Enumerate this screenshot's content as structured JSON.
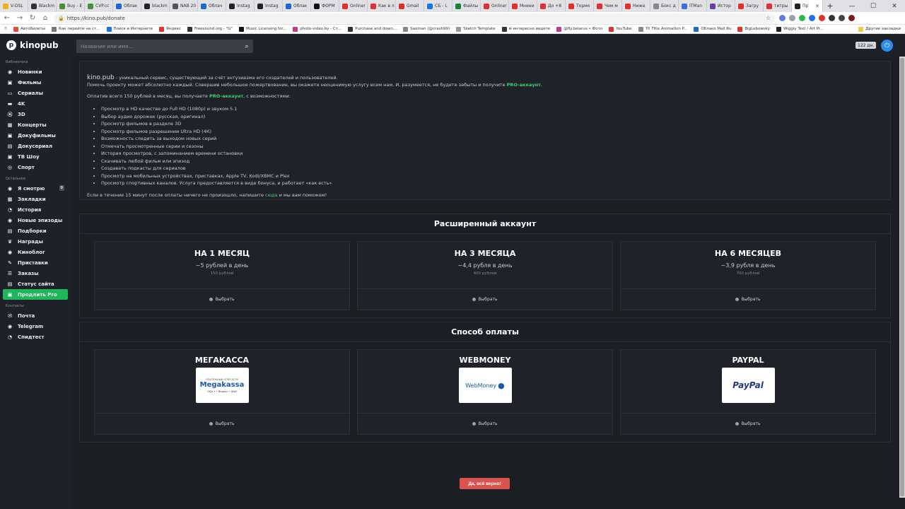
{
  "browser": {
    "tabs": [
      {
        "label": "V-DSL",
        "color": "#f2b01e"
      },
      {
        "label": "Blackm",
        "color": "#333333"
      },
      {
        "label": "Buy - E",
        "color": "#4a8d3a"
      },
      {
        "label": "CVP.cc",
        "color": "#4a8d3a"
      },
      {
        "label": "Облак",
        "color": "#2266cc"
      },
      {
        "label": "blackm",
        "color": "#222222"
      },
      {
        "label": "NAB 20",
        "color": "#555555"
      },
      {
        "label": "Облач",
        "color": "#2266cc"
      },
      {
        "label": "Instag",
        "color": "#222222"
      },
      {
        "label": "Instag",
        "color": "#222222"
      },
      {
        "label": "Облак",
        "color": "#2266cc"
      },
      {
        "label": "ФОРМ",
        "color": "#111111"
      },
      {
        "label": "Onliner",
        "color": "#e0312a"
      },
      {
        "label": "Как в л",
        "color": "#e0312a"
      },
      {
        "label": "Gmail",
        "color": "#d93025"
      },
      {
        "label": "СБ - L",
        "color": "#1a73e8"
      },
      {
        "label": "Файлы",
        "color": "#188038"
      },
      {
        "label": "Onliner",
        "color": "#e0312a"
      },
      {
        "label": "Мнени",
        "color": "#e0312a"
      },
      {
        "label": "До +8",
        "color": "#e0312a"
      },
      {
        "label": "Тормо",
        "color": "#e0312a"
      },
      {
        "label": "Чем м",
        "color": "#e0312a"
      },
      {
        "label": "Ниже",
        "color": "#e0312a"
      },
      {
        "label": "Бокс д",
        "color": "#888888"
      },
      {
        "label": "ITMan",
        "color": "#3d6fd6"
      },
      {
        "label": "Истор",
        "color": "#6b3fa0"
      },
      {
        "label": "Загру",
        "color": "#e0312a"
      },
      {
        "label": "титры",
        "color": "#e0312a"
      },
      {
        "label": "Пр",
        "color": "#222222",
        "active": true
      }
    ],
    "new_tab": "+",
    "url": "https://kino.pub/donate",
    "bookmarks": [
      {
        "label": "Автобилеты",
        "color": "#e84c3d"
      },
      {
        "label": "Как перейти на ст...",
        "color": "#777777"
      },
      {
        "label": "Поиск в Интернете",
        "color": "#1a73e8"
      },
      {
        "label": "Яндекс",
        "color": "#e0312a"
      },
      {
        "label": "Freesound.org - \"G\"",
        "color": "#333333"
      },
      {
        "label": "Music Licensing for...",
        "color": "#111111"
      },
      {
        "label": "photo-video.by - Ст...",
        "color": "#c0398a"
      },
      {
        "label": "Purchase and down...",
        "color": "#333333"
      },
      {
        "label": "Saoman (@crash99)",
        "color": "#888888"
      },
      {
        "label": "Sketch Template",
        "color": "#999999"
      },
      {
        "label": "м интересно ведете",
        "color": "#333333"
      },
      {
        "label": "@fly.belarus • Фото",
        "color": "#c0398a"
      },
      {
        "label": "YouTube",
        "color": "#e0312a"
      },
      {
        "label": "70 Title Animation P...",
        "color": "#888888"
      },
      {
        "label": "Облако Mail.Ru",
        "color": "#2266cc"
      },
      {
        "label": "BigLebowsky",
        "color": "#e0312a"
      },
      {
        "label": "Wiggly Text / Art Pr...",
        "color": "#222222"
      }
    ],
    "other_bookmarks": "Другие закладки"
  },
  "header": {
    "logo": "kinopub",
    "search_placeholder": "Название или имя...",
    "days_left": "122 дн."
  },
  "sidebar": {
    "sections": [
      {
        "title": "Библиотека",
        "items": [
          {
            "label": "Новинки",
            "icon": "◉"
          },
          {
            "label": "Фильмы",
            "icon": "▣"
          },
          {
            "label": "Сериалы",
            "icon": "▭"
          },
          {
            "label": "4K",
            "icon": "▬"
          },
          {
            "label": "3D",
            "icon": "⦿"
          },
          {
            "label": "Концерты",
            "icon": "▦"
          },
          {
            "label": "Докуфильмы",
            "icon": "▣"
          },
          {
            "label": "Докусериал",
            "icon": "▤"
          },
          {
            "label": "ТВ Шоу",
            "icon": "▣"
          },
          {
            "label": "Спорт",
            "icon": "◎"
          }
        ]
      },
      {
        "title": "Остальное",
        "items": [
          {
            "label": "Я смотрю",
            "icon": "◉",
            "badge": "0"
          },
          {
            "label": "Закладки",
            "icon": "▦"
          },
          {
            "label": "История",
            "icon": "◔"
          },
          {
            "label": "Новые эпизоды",
            "icon": "◉"
          },
          {
            "label": "Подборки",
            "icon": "▤"
          },
          {
            "label": "Награды",
            "icon": "♛"
          },
          {
            "label": "Киноблог",
            "icon": "◉"
          },
          {
            "label": "Приставки",
            "icon": "✎"
          },
          {
            "label": "Заказы",
            "icon": "☰"
          },
          {
            "label": "Статус сайта",
            "icon": "▤"
          },
          {
            "label": "Продлить Pro",
            "icon": "▣",
            "active": true
          }
        ]
      },
      {
        "title": "Контакты",
        "items": [
          {
            "label": "Почта",
            "icon": "✉"
          },
          {
            "label": "Telegram",
            "icon": "◉"
          },
          {
            "label": "Спидтест",
            "icon": "◔"
          }
        ]
      }
    ]
  },
  "info": {
    "brand": "kino.pub",
    "intro_rest": " - уникальный сервис, существующий за счёт энтузиазма его создателей и пользователей.",
    "line2_pre": "Помочь проекту может абсолютно каждый. Совершив небольшое пожертвование, вы окажете неоценимую услугу всем нам. И, разумеется, не будете забыты и получите ",
    "pro_account": "PRO-аккаунт",
    "line2_post": ".",
    "pay_pre": "Оплатив всего 150 рублей в месяц, вы получаете ",
    "pay_pro": "PRO-аккаунт",
    "pay_post": ", с возможностями:",
    "features": [
      "Просмотр в HD качестве до Full HD (1080p) и звуком 5.1",
      "Выбор аудио дорожек (русская, оригинал)",
      "Просмотр фильмов в разделе 3D",
      "Просмотр фильмов разрешении Ultra HD (4К)",
      "Возможность следить за выходом новых серий",
      "Отмечать просмотренные серии и сезоны",
      "История просмотров, с запоминанием времени остановки",
      "Скачивать любой фильм или эпизод",
      "Создавать подкасты для сериалов",
      "Просмотр на мобильных устройствах, приставках, Apple TV, Kodi/XBMC и Plex",
      "Просмотр спортивных каналов. Услуга предоставляется в виде бонуса, и работает «как есть»"
    ],
    "footer_pre": "Если в течение 15 минут после оплаты ничего не произошло, напишите ",
    "footer_link": "сюда",
    "footer_post": " и мы вам поможем!"
  },
  "plans": {
    "title": "Расширенный аккаунт",
    "items": [
      {
        "title": "НА 1 МЕСЯЦ",
        "per_day": "~5 рублей в день",
        "price": "150 рублей",
        "button": "Выбрать"
      },
      {
        "title": "НА 3 МЕСЯЦА",
        "per_day": "~4,4 рубля в день",
        "price": "400 рублей",
        "button": "Выбрать"
      },
      {
        "title": "НА 6 МЕСЯЦЕВ",
        "per_day": "~3,9 рубля в день",
        "price": "700 рублей",
        "button": "Выбрать"
      }
    ]
  },
  "payment": {
    "title": "Способ оплаты",
    "items": [
      {
        "title": "МЕГАКАССА",
        "logo_top": "ПЛАТЕЖНЫЙ АГРЕГАТОР",
        "logo_text": "Megakassa",
        "logo_bottom": "VISA • • Яндекс • QIWI",
        "button": "Выбрать"
      },
      {
        "title": "WEBMONEY",
        "logo_text": "WebMoney",
        "button": "Выбрать"
      },
      {
        "title": "PAYPAL",
        "logo_text": "PayPal",
        "button": "Выбрать"
      }
    ]
  },
  "confirm_label": "Да, всё верно!",
  "colors": {
    "accent_green": "#1eb85a",
    "confirm_red": "#d9534f",
    "power_blue": "#2d8cf0"
  }
}
